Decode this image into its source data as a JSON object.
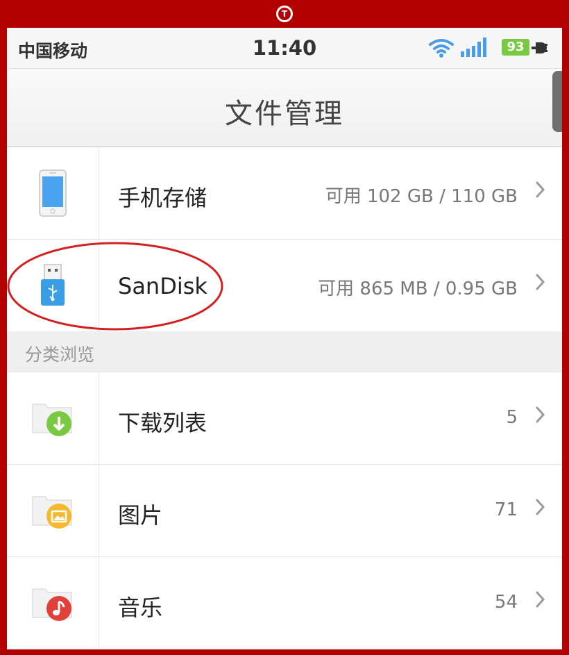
{
  "status_bar": {
    "carrier": "中国移动",
    "time": "11:40",
    "battery": "93"
  },
  "header": {
    "title": "文件管理"
  },
  "storage": [
    {
      "label": "手机存储",
      "info": "可用 102 GB / 110 GB",
      "icon": "phone-icon"
    },
    {
      "label": "SanDisk",
      "info": "可用 865 MB / 0.95 GB",
      "icon": "usb-drive-icon"
    }
  ],
  "categories": {
    "header": "分类浏览",
    "items": [
      {
        "label": "下载列表",
        "count": "5",
        "icon": "download-folder-icon"
      },
      {
        "label": "图片",
        "count": "71",
        "icon": "image-folder-icon"
      },
      {
        "label": "音乐",
        "count": "54",
        "icon": "music-folder-icon"
      }
    ]
  },
  "colors": {
    "frame": "#b30000",
    "annotation_ring": "#d42020",
    "download_badge": "#7ac943",
    "image_badge": "#f5b82e",
    "music_badge": "#e0413a",
    "battery": "#7ac943",
    "wifi": "#4a9be8"
  }
}
